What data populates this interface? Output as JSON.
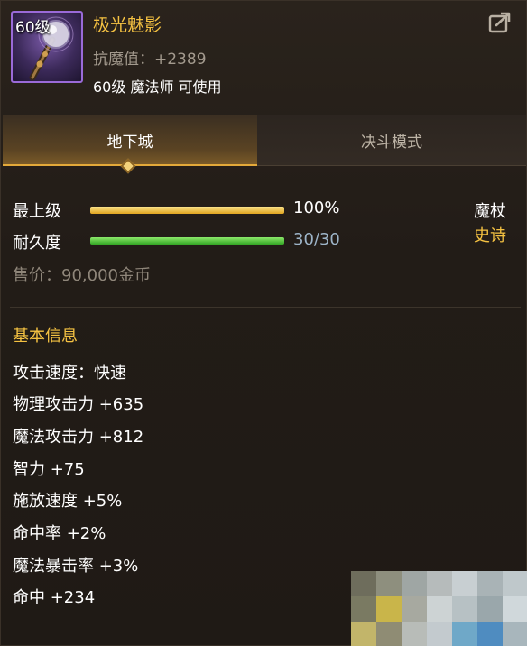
{
  "item": {
    "level_badge": "60级",
    "name": "极光魅影",
    "resist": "抗魔值：+2389",
    "usable": "60级 魔法师 可使用"
  },
  "tabs": [
    {
      "label": "地下城",
      "active": true
    },
    {
      "label": "决斗模式",
      "active": false
    }
  ],
  "bars": {
    "upgrade": {
      "label": "最上级",
      "value_text": "100%",
      "fraction": 1.0
    },
    "durability": {
      "label": "耐久度",
      "value_text": "30/30",
      "fraction": 1.0
    }
  },
  "weapon_type": "魔杖",
  "rarity": "史诗",
  "price": "售价：90,000金币",
  "basic_info": {
    "title": "基本信息",
    "stats": [
      "攻击速度：快速",
      "物理攻击力 +635",
      "魔法攻击力 +812",
      "智力 +75",
      "施放速度 +5%",
      "命中率 +2%",
      "魔法暴击率 +3%",
      "命中 +234"
    ]
  },
  "colors": {
    "name_gold": "#f5c242",
    "rarity_gold": "#f5c242",
    "durability_text": "#9db4c8",
    "epic_border": "#9a6ad8"
  },
  "icons": {
    "share": "share-icon",
    "item": "staff-icon"
  }
}
